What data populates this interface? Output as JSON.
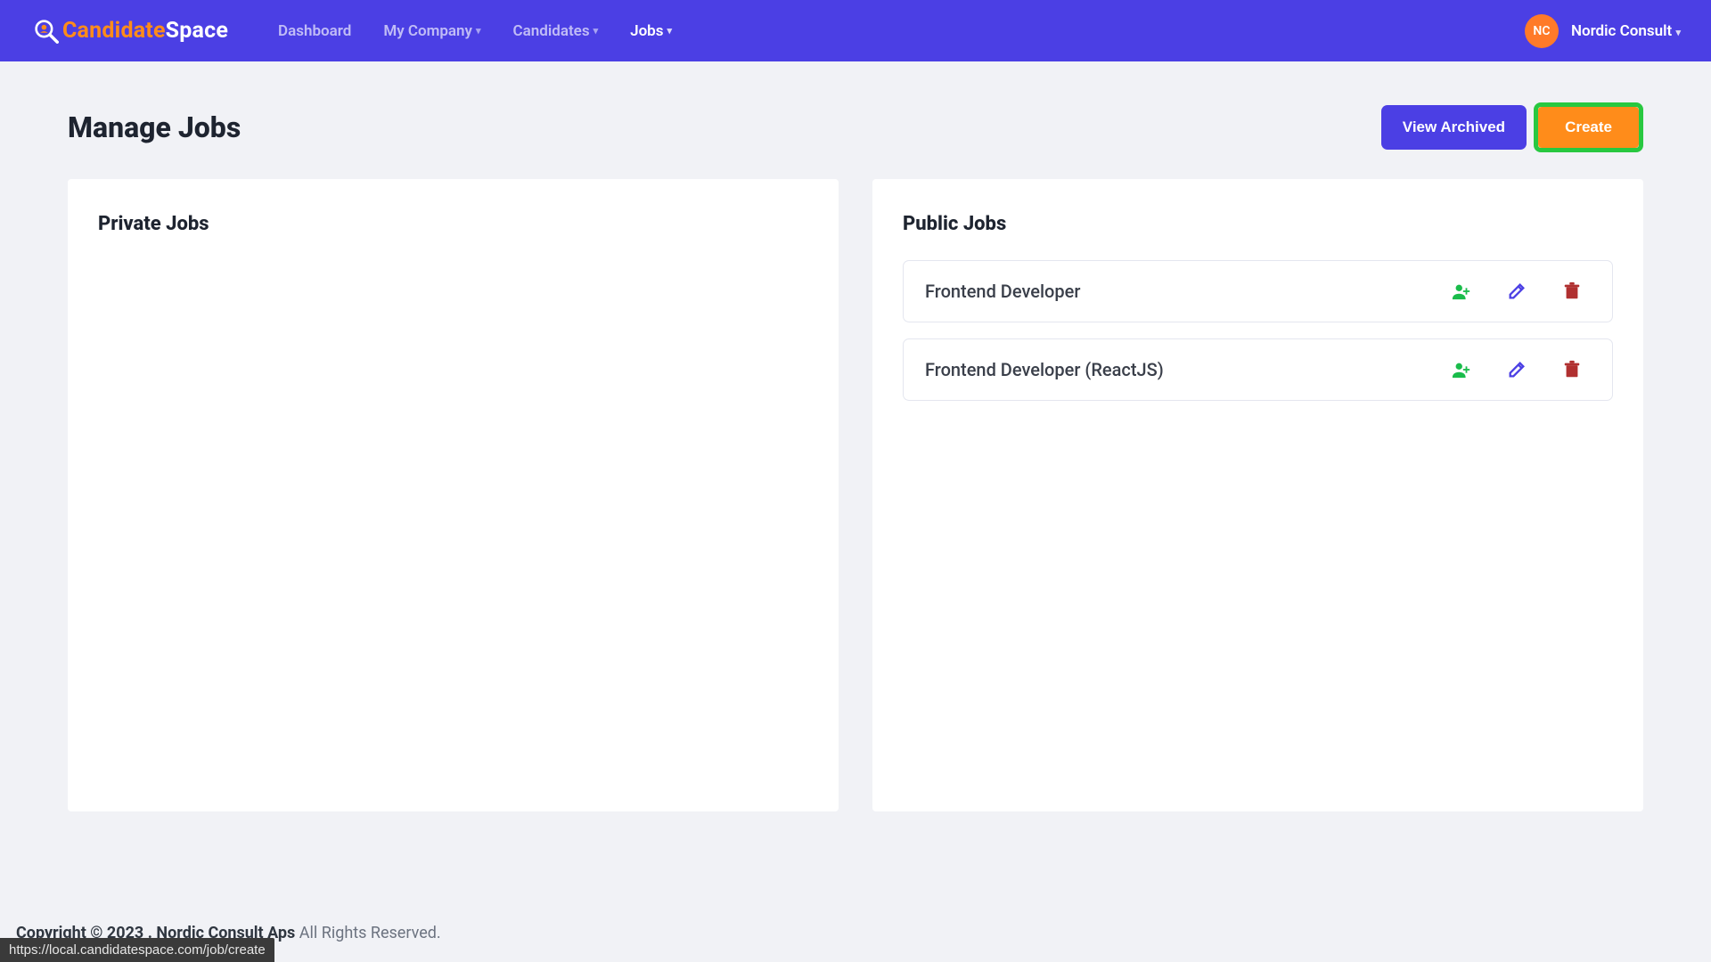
{
  "brand": {
    "name_first": "Candidate",
    "name_second": "Space"
  },
  "nav": {
    "items": [
      {
        "label": "Dashboard",
        "dropdown": false,
        "active": false
      },
      {
        "label": "My Company",
        "dropdown": true,
        "active": false
      },
      {
        "label": "Candidates",
        "dropdown": true,
        "active": false
      },
      {
        "label": "Jobs",
        "dropdown": true,
        "active": true
      }
    ],
    "avatar_initials": "NC",
    "company": "Nordic Consult"
  },
  "header": {
    "title": "Manage Jobs",
    "view_archived_label": "View Archived",
    "create_label": "Create"
  },
  "private_panel": {
    "title": "Private Jobs",
    "jobs": []
  },
  "public_panel": {
    "title": "Public Jobs",
    "jobs": [
      {
        "title": "Frontend Developer"
      },
      {
        "title": "Frontend Developer (ReactJS)"
      }
    ]
  },
  "footer": {
    "copyright": "Copyright © 2023 . ",
    "company": "Nordic Consult Aps",
    "rights": "  All Rights Reserved."
  },
  "status_url": "https://local.candidatespace.com/job/create"
}
